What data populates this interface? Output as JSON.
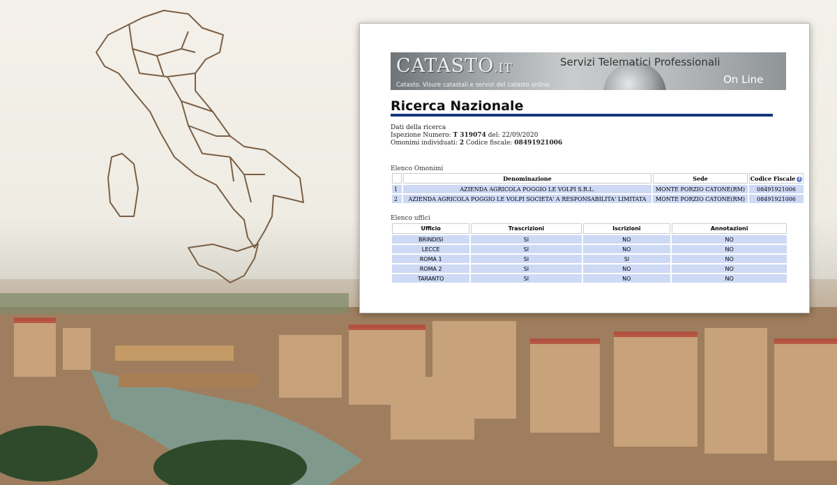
{
  "banner": {
    "brand": "CATASTO",
    "brand_suffix": ".IT",
    "tagline": "Catasto. Visure catastali e servizi del catasto online.",
    "service_title": "Servizi Telematici Professionali",
    "online_label": "On Line"
  },
  "page": {
    "title": "Ricerca Nazionale"
  },
  "search": {
    "heading": "Dati della ricerca",
    "inspection_label": "Ispezione Numero:",
    "inspection_number": "T 319074",
    "date_label": "del:",
    "date": "22/09/2020",
    "omonimi_label": "Omonimi individuati:",
    "omonimi_count": "2",
    "fiscal_label": "Codice fiscale:",
    "fiscal_code": "08491921006"
  },
  "omonimi": {
    "section_label": "Elenco Omonimi",
    "headers": [
      "Denominazione",
      "Sede",
      "Codice Fiscale"
    ],
    "rows": [
      {
        "n": "1",
        "name": "AZIENDA AGRICOLA POGGIO LE VOLPI S.R.L.",
        "sede": "MONTE PORZIO CATONE(RM)",
        "cf": "08491921006"
      },
      {
        "n": "2",
        "name": "AZIENDA AGRICOLA POGGIO LE VOLPI SOCIETA' A RESPONSABILITA' LIMITATA",
        "sede": "MONTE PORZIO CATONE(RM)",
        "cf": "08491921006"
      }
    ]
  },
  "uffici": {
    "section_label": "Elenco uffici",
    "headers": [
      "Ufficio",
      "Trascrizioni",
      "Iscrizioni",
      "Annotazioni"
    ],
    "rows": [
      [
        "BRINDISI",
        "SI",
        "NO",
        "NO"
      ],
      [
        "LECCE",
        "SI",
        "NO",
        "NO"
      ],
      [
        "ROMA 1",
        "SI",
        "SI",
        "NO"
      ],
      [
        "ROMA 2",
        "SI",
        "NO",
        "NO"
      ],
      [
        "TARANTO",
        "SI",
        "NO",
        "NO"
      ]
    ]
  },
  "colors": {
    "accent_rule": "#14367a",
    "row_fill": "#cdd9f5"
  }
}
